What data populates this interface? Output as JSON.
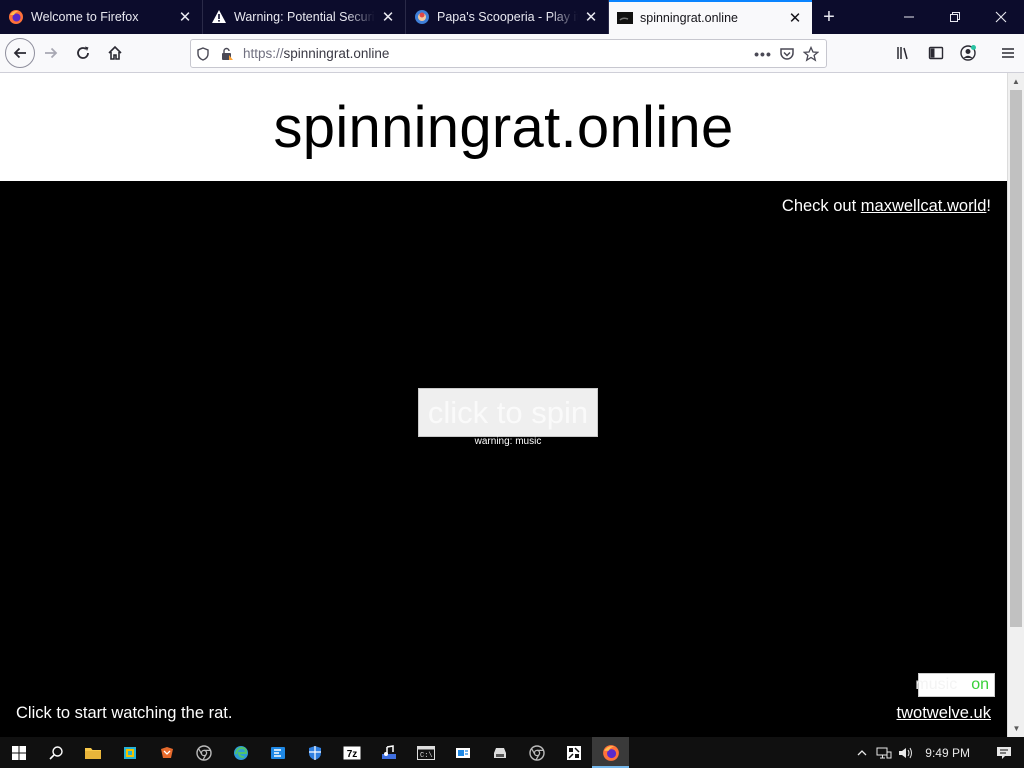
{
  "browser": {
    "tabs": [
      {
        "title": "Welcome to Firefox",
        "icon": "firefox-icon"
      },
      {
        "title": "Warning: Potential Security Risk Ahead",
        "icon": "warning-icon"
      },
      {
        "title": "Papa's Scooperia - Play it Online",
        "icon": "game-icon"
      },
      {
        "title": "spinningrat.online",
        "icon": "rat-icon",
        "active": true
      }
    ],
    "new_tab_label": "+",
    "url_protocol": "https://",
    "url_host": "spinningrat.online",
    "accent_color": "#0a84ff"
  },
  "page": {
    "title": "spinningrat.online",
    "checkout_prefix": "Check out ",
    "checkout_link": "maxwellcat.world",
    "checkout_suffix": "!",
    "spin_button": "click to spin",
    "warning_text": "warning: music",
    "toggle_off_label": "music",
    "toggle_on_label": "on",
    "bottom_left_text": "Click to start watching the rat.",
    "bottom_right_link": "twotwelve.uk"
  },
  "taskbar": {
    "clock": "9:49 PM",
    "apps": [
      "start-icon",
      "search-icon",
      "file-explorer-icon",
      "app-icon",
      "app-icon",
      "chrome-icon",
      "edge-icon",
      "app-icon",
      "security-icon",
      "7zip-icon",
      "music-icon",
      "cmd-icon",
      "app-icon",
      "app-icon",
      "chrome-icon",
      "app-icon",
      "firefox-icon"
    ]
  }
}
